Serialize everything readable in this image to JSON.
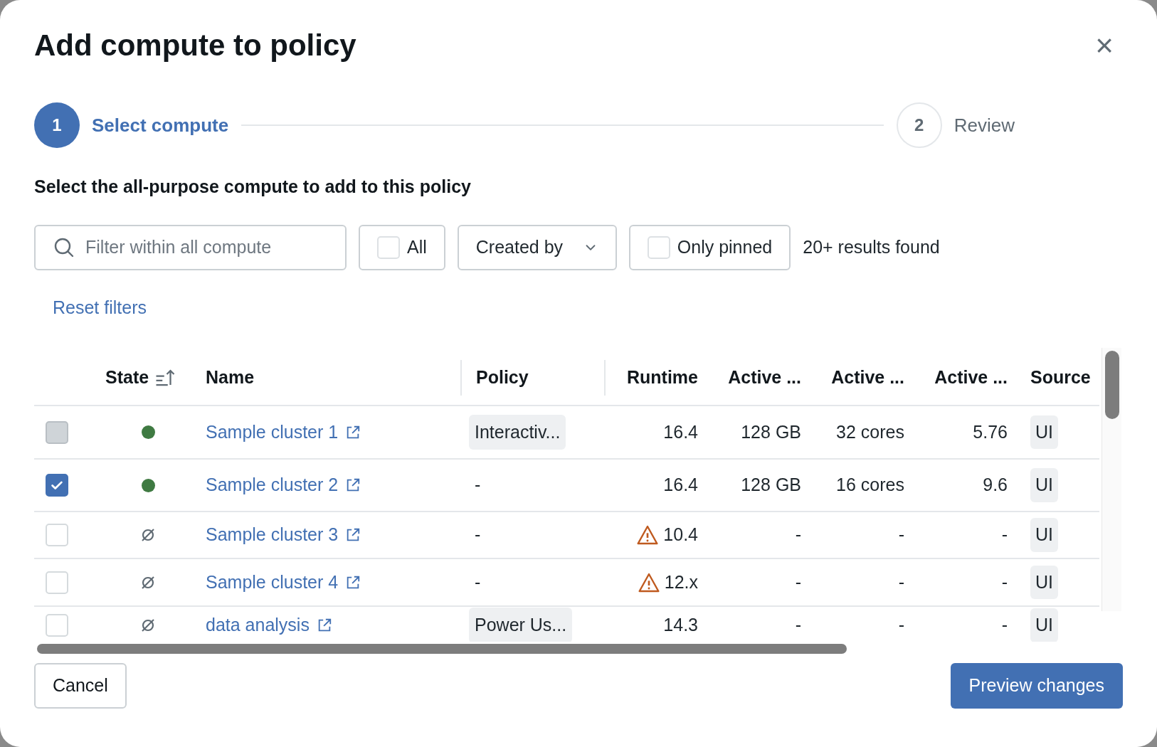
{
  "dialog": {
    "title": "Add compute to policy",
    "close": "×"
  },
  "steps": [
    {
      "number": "1",
      "label": "Select compute",
      "selected": true
    },
    {
      "number": "2",
      "label": "Review",
      "selected": false
    }
  ],
  "instruction": "Select the all-purpose compute to add to this policy",
  "filters": {
    "search": {
      "placeholder": "Filter within all compute"
    },
    "all": {
      "label": "All",
      "checked": false
    },
    "created_by": {
      "label": "Created by"
    },
    "only_pinned": {
      "label": "Only pinned",
      "checked": false
    },
    "results": "20+ results found",
    "reset": "Reset filters"
  },
  "table": {
    "columns": [
      "State",
      "Name",
      "Policy",
      "Runtime",
      "Active ...",
      "Active ...",
      "Active ...",
      "Source"
    ],
    "rows": [
      {
        "selected": false,
        "disabled": true,
        "running": true,
        "name": "Sample cluster 1",
        "policy": "Interactiv...",
        "policy_tag": true,
        "runtime": "16.4",
        "warning": false,
        "active_1": "128 GB",
        "active_2": "32 cores",
        "active_3": "5.76",
        "source": "UI"
      },
      {
        "selected": true,
        "disabled": false,
        "running": true,
        "name": "Sample cluster 2",
        "policy": "-",
        "policy_tag": false,
        "runtime": "16.4",
        "warning": false,
        "active_1": "128 GB",
        "active_2": "16 cores",
        "active_3": "9.6",
        "source": "UI"
      },
      {
        "selected": false,
        "disabled": false,
        "running": false,
        "name": "Sample cluster 3",
        "policy": "-",
        "policy_tag": false,
        "runtime": "10.4",
        "warning": true,
        "active_1": "-",
        "active_2": "-",
        "active_3": "-",
        "source": "UI"
      },
      {
        "selected": false,
        "disabled": false,
        "running": false,
        "name": "Sample cluster 4",
        "policy": "-",
        "policy_tag": false,
        "runtime": "12.x",
        "warning": true,
        "active_1": "-",
        "active_2": "-",
        "active_3": "-",
        "source": "UI"
      },
      {
        "selected": false,
        "disabled": false,
        "running": false,
        "name": "data analysis",
        "policy": "Power Us...",
        "policy_tag": true,
        "runtime": "14.3",
        "warning": false,
        "active_1": "-",
        "active_2": "-",
        "active_3": "-",
        "source": "UI"
      }
    ]
  },
  "buttons": {
    "cancel": "Cancel",
    "preview": "Preview changes"
  }
}
